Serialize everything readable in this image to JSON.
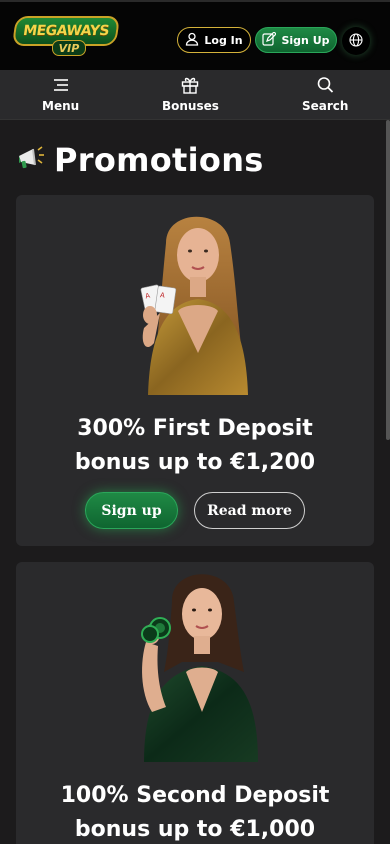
{
  "header": {
    "logo_top": "MEGAWAYS",
    "logo_bottom": "VIP",
    "login_label": "Log In",
    "signup_label": "Sign Up"
  },
  "nav": {
    "menu_label": "Menu",
    "bonuses_label": "Bonuses",
    "search_label": "Search"
  },
  "main": {
    "title": "Promotions",
    "promos": [
      {
        "title_line1": "300% First Deposit",
        "title_line2": "bonus up to €1,200",
        "signup_label": "Sign up",
        "read_more_label": "Read more"
      },
      {
        "title_line1": "100% Second Deposit",
        "title_line2": "bonus up to €1,000"
      }
    ]
  },
  "colors": {
    "accent_green": "#1f8a45",
    "gold": "#d4b23a",
    "background": "#1c1b1c",
    "card": "#2a2a2c"
  },
  "icons": [
    "user-icon",
    "edit-icon",
    "globe-icon",
    "menu-icon",
    "gift-icon",
    "search-icon",
    "megaphone-icon"
  ]
}
